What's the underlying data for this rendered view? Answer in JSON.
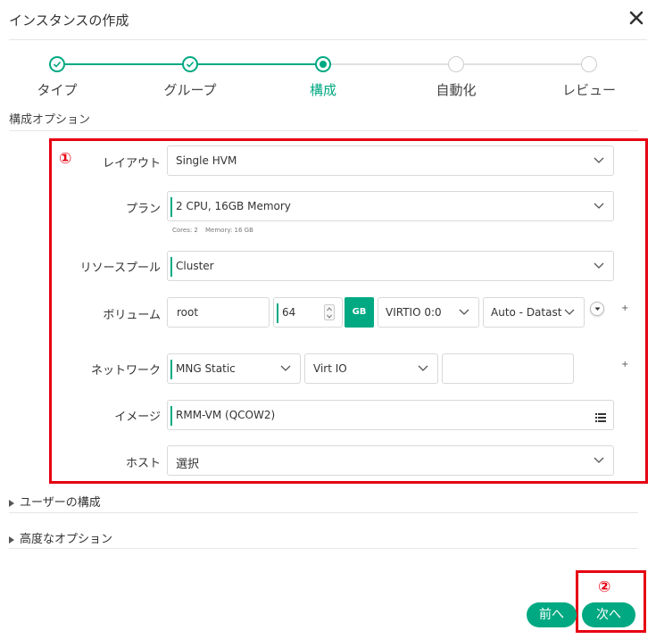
{
  "header": {
    "title": "インスタンスの作成"
  },
  "steps": [
    {
      "label": "タイプ",
      "state": "done"
    },
    {
      "label": "グループ",
      "state": "done"
    },
    {
      "label": "構成",
      "state": "current"
    },
    {
      "label": "自動化",
      "state": "todo"
    },
    {
      "label": "レビュー",
      "state": "todo"
    }
  ],
  "section": {
    "title": "構成オプション"
  },
  "annotations": {
    "one": "①",
    "two": "②"
  },
  "form": {
    "layout": {
      "label": "レイアウト",
      "value": "Single HVM"
    },
    "plan": {
      "label": "プラン",
      "value": "2 CPU, 16GB Memory",
      "sub_cores": "Cores: 2",
      "sub_memory": "Memory: 16 GB"
    },
    "pool": {
      "label": "リソースプール",
      "value": "Cluster"
    },
    "volume": {
      "label": "ボリューム",
      "name": "root",
      "size": "64",
      "unit": "GB",
      "controller": "VIRTIO 0:0",
      "datastore": "Auto - Datasto"
    },
    "network": {
      "label": "ネットワーク",
      "network": "MNG Static",
      "type": "Virt IO",
      "ip": ""
    },
    "image": {
      "label": "イメージ",
      "value": "RMM-VM (QCOW2)"
    },
    "host": {
      "label": "ホスト",
      "value": "選択"
    },
    "plus_symbol": "+"
  },
  "collapsibles": {
    "user_config": "ユーザーの構成",
    "advanced": "高度なオプション"
  },
  "buttons": {
    "prev": "前へ",
    "next": "次へ"
  },
  "colors": {
    "accent": "#01a982",
    "annotation": "#e60012"
  }
}
